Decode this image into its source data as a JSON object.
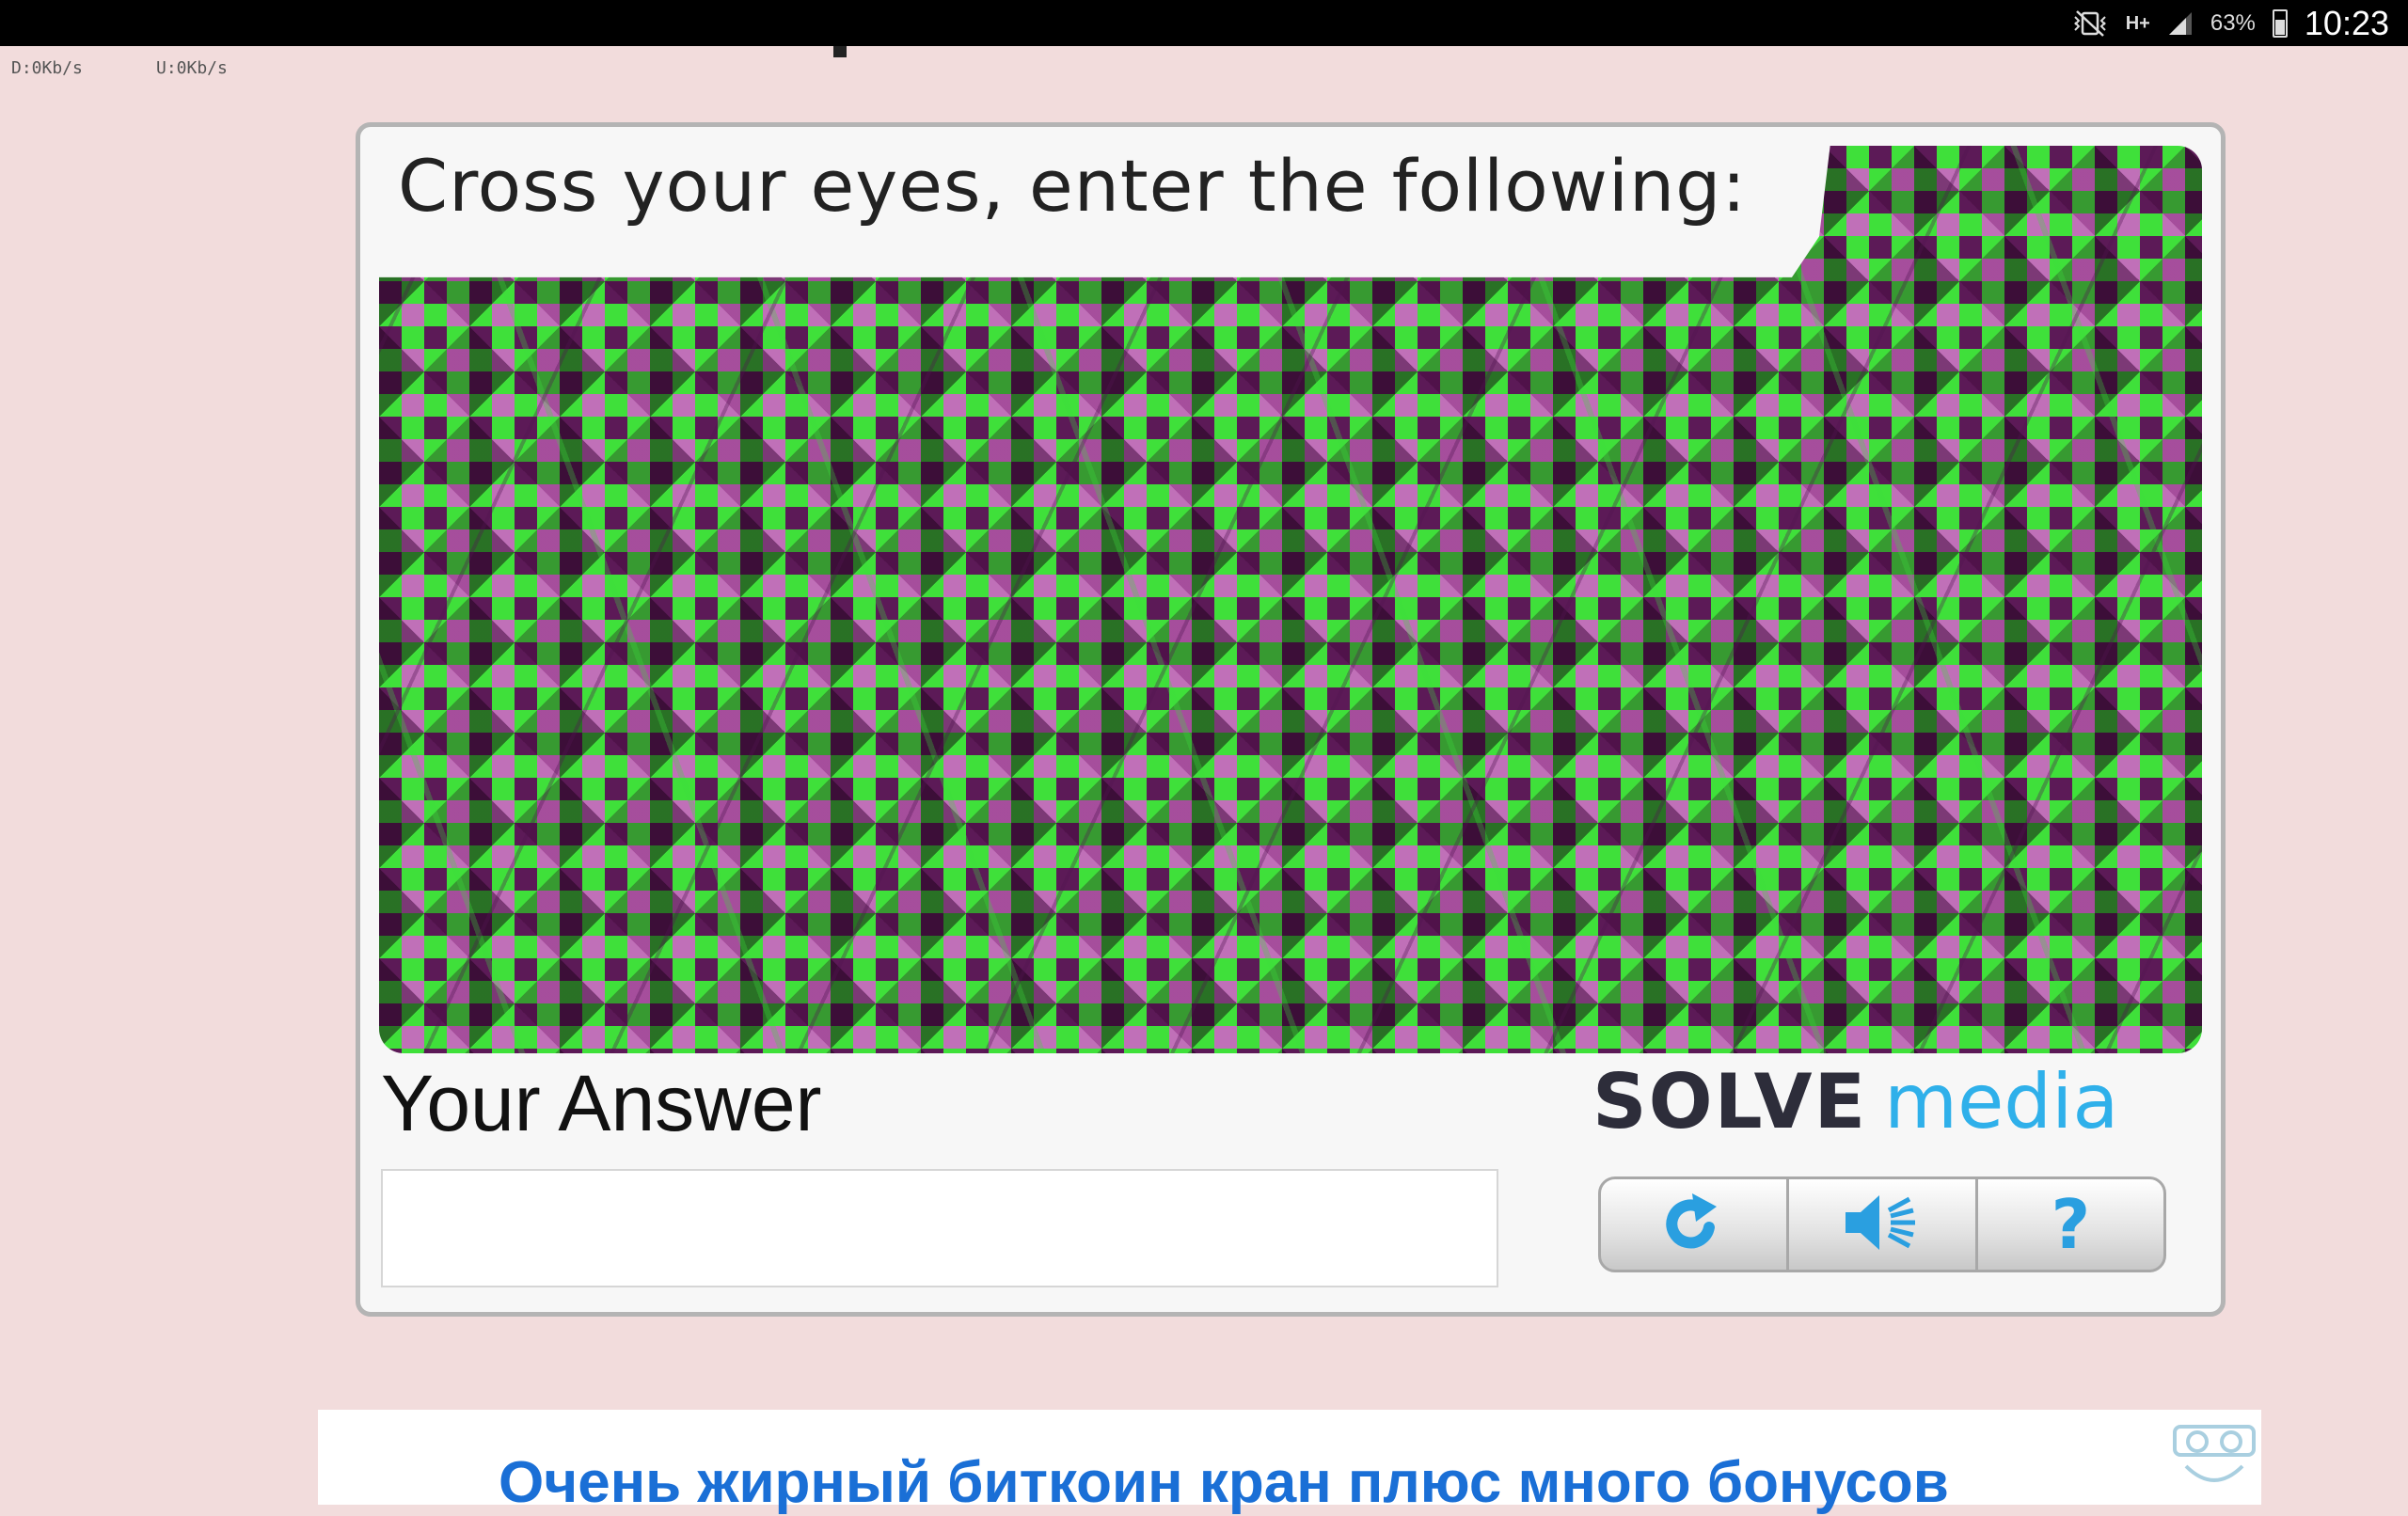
{
  "status_bar": {
    "signal_type": "H+",
    "battery_percent": "63%",
    "time": "10:23",
    "icons": [
      "mute-vibrate-icon",
      "network-type-icon",
      "signal-strength-icon",
      "battery-icon"
    ]
  },
  "net_speed": {
    "download": "D:0Kb/s",
    "upload": "U:0Kb/s"
  },
  "captcha": {
    "instruction": "Cross your eyes, enter the following:",
    "answer_label": "Your Answer",
    "answer_value": "",
    "brand_solve": "SOLVE",
    "brand_media": "media",
    "controls": {
      "refresh_icon": "refresh-icon",
      "audio_icon": "speaker-icon",
      "help_label": "?"
    },
    "colors": {
      "green": "#3fe03a",
      "light_purple": "#c070b8",
      "dark_purple": "#5c1a57",
      "brand_blue": "#2fb0ea"
    }
  },
  "ad": {
    "text": "Очень жирный биткоин кран плюс много бонусов",
    "icon": "mascot-icon",
    "color": "#1a6fd6"
  }
}
